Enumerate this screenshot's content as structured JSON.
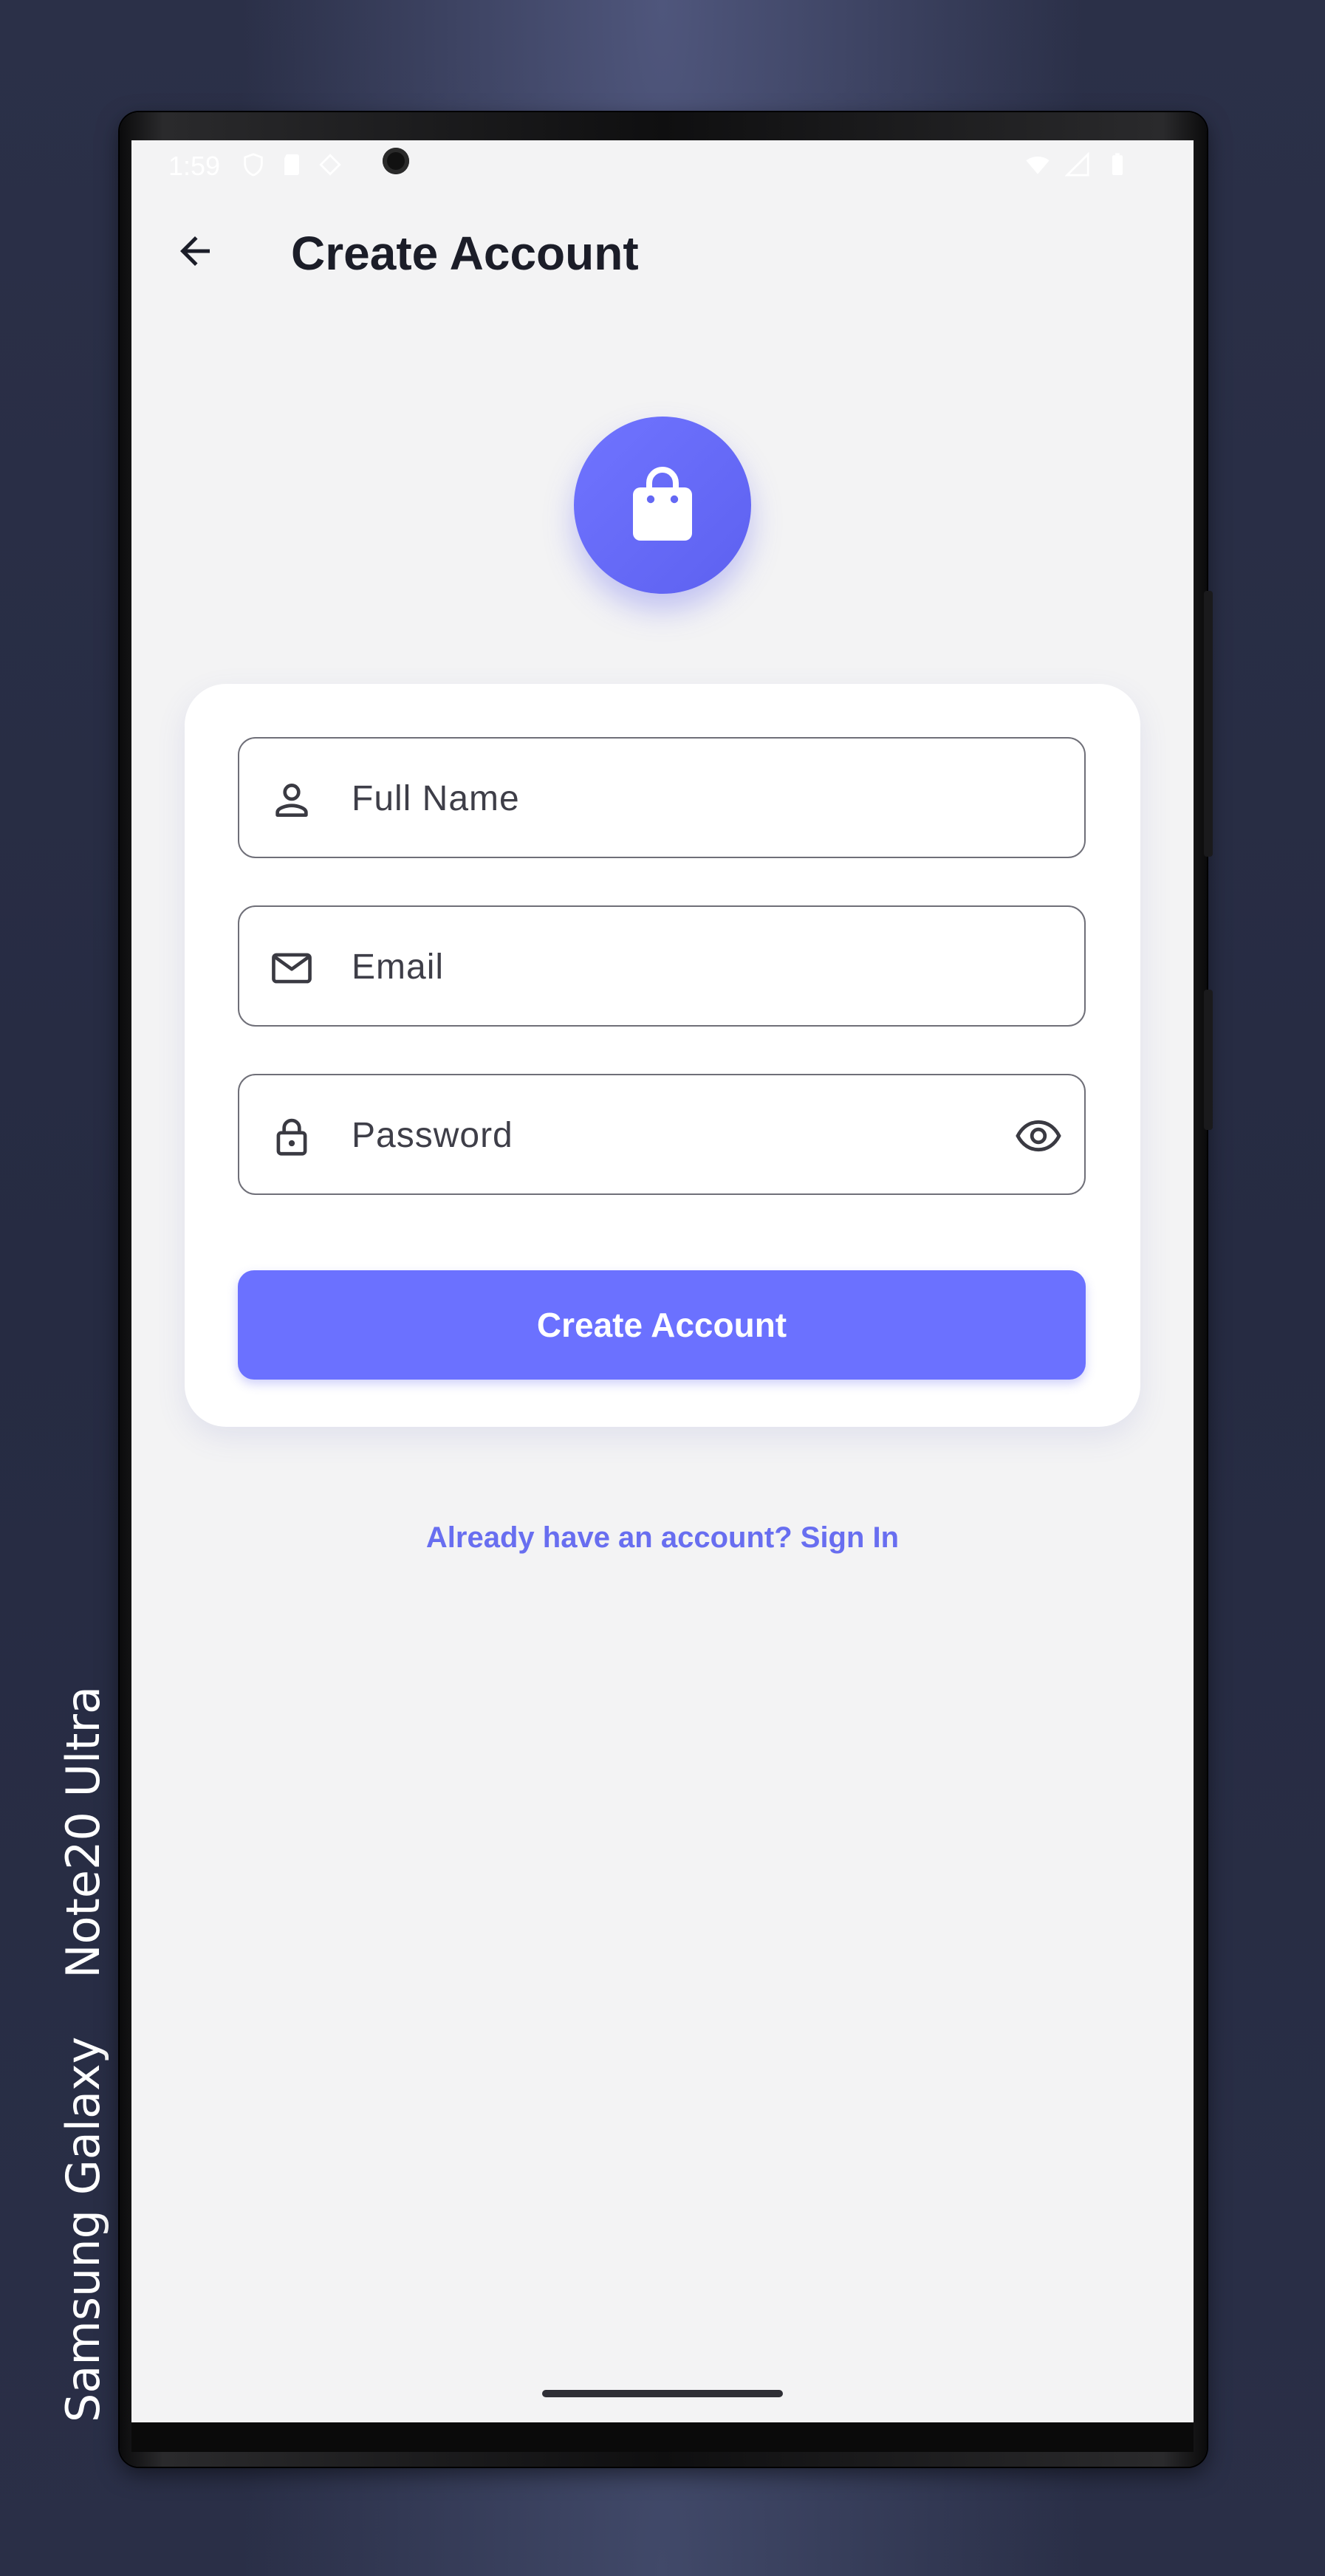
{
  "device": {
    "label_brand": "Samsung Galaxy",
    "label_model": "Note20 Ultra"
  },
  "status_bar": {
    "time": "1:59"
  },
  "app_bar": {
    "title": "Create Account",
    "back_icon": "arrow-back-icon"
  },
  "logo": {
    "icon": "shopping-bag-icon"
  },
  "form": {
    "full_name": {
      "placeholder": "Full Name",
      "value": "",
      "icon": "person-icon"
    },
    "email": {
      "placeholder": "Email",
      "value": "",
      "icon": "mail-icon"
    },
    "password": {
      "placeholder": "Password",
      "value": "",
      "icon": "lock-icon",
      "toggle_icon": "eye-icon"
    },
    "submit_label": "Create Account"
  },
  "footer": {
    "signin_link": "Already have an account? Sign In"
  },
  "colors": {
    "accent": "#6b71ff",
    "link": "#686ef0",
    "background": "#f3f3f4",
    "card": "#ffffff",
    "title": "#1b1d28"
  }
}
